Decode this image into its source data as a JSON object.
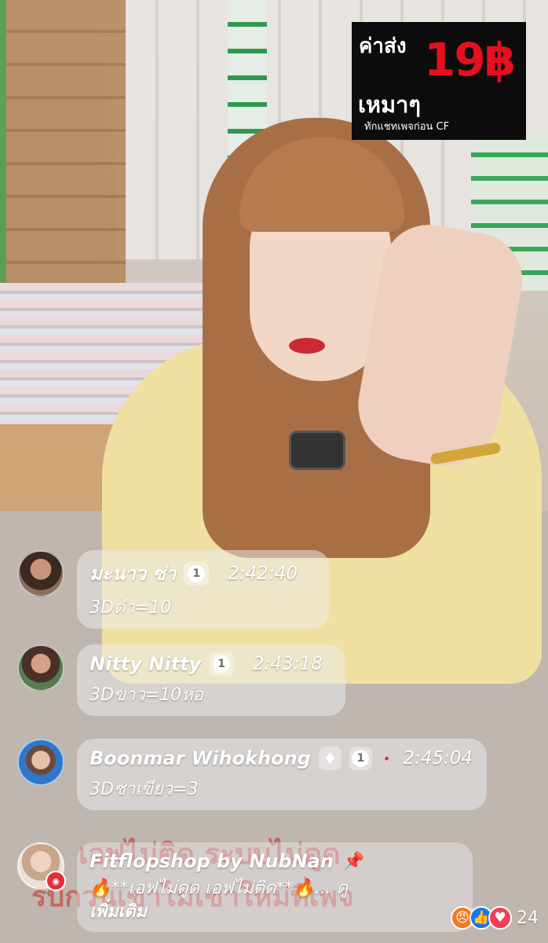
{
  "promo": {
    "line1": "ค่าส่ง",
    "price": "19฿",
    "line2": "เหมาๆ",
    "line3": "ทักแชทเพจก่อน CF"
  },
  "banner": {
    "line1": "เอฟไม่ติด ระบบไม่ดูด",
    "line2": "รบกวนเขาไม่เขาใหม่ที่เพจ"
  },
  "comments": [
    {
      "name": "มะนาว ซ่า",
      "badge": "1",
      "time": "2:42:40",
      "text": "3Dดำ=10"
    },
    {
      "name": "Nitty Nitty",
      "badge": "1",
      "time": "2:43:18",
      "text": "3Dขาว=10ห่อ"
    },
    {
      "name": "Boonmar Wihokhong",
      "badge": "1",
      "time": "2:45:04",
      "text": "3Dชาเขียว=3"
    }
  ],
  "pinned": {
    "name": "Fitflopshop by NubNan",
    "text": "🔥**เอฟไม่ดูด เอฟไม่ติด**🔥... ดู",
    "more": "เพิ่มเติม"
  },
  "reactions": {
    "icons": [
      "angry-icon",
      "like-icon",
      "love-icon"
    ],
    "count": "24"
  },
  "colors": {
    "promo_bg": "#0c0c0c",
    "price_red": "#e60f1e",
    "like_blue": "#1877f2",
    "love_red": "#f33e58",
    "angry_orange": "#f07a22"
  }
}
